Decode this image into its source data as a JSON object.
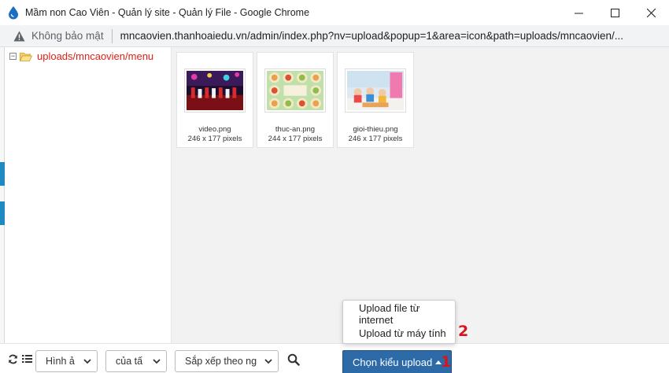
{
  "window": {
    "title": "Mầm non Cao Viên - Quản lý site - Quản lý File - Google Chrome",
    "controls": {
      "minimize": "—",
      "maximize": "☐",
      "close": "✕"
    }
  },
  "address_bar": {
    "security_text": "Không bảo mật",
    "url": "mncaovien.thanhoaiedu.vn/admin/index.php?nv=upload&popup=1&area=icon&path=uploads/mncaovien/..."
  },
  "tree": {
    "toggle": "−",
    "folder_label": "uploads/mncaovien/menu"
  },
  "files": [
    {
      "name": "video.png",
      "dims": "246 x 177 pixels"
    },
    {
      "name": "thuc-an.png",
      "dims": "244 x 177 pixels"
    },
    {
      "name": "gioi-thieu.png",
      "dims": "246 x 177 pixels"
    }
  ],
  "toolbar": {
    "filter_type": "Hình ả",
    "filter_owner": "của tấ",
    "sort": "Sắp xếp theo ng",
    "upload_button": "Chọn kiểu upload"
  },
  "upload_menu": {
    "items": [
      "Upload file từ internet",
      "Upload từ máy tính"
    ]
  },
  "markers": {
    "one": "1",
    "two": "2"
  },
  "colors": {
    "accent": "#2c6aa8",
    "marker": "#d9141c",
    "folder_label": "#e0201a"
  }
}
